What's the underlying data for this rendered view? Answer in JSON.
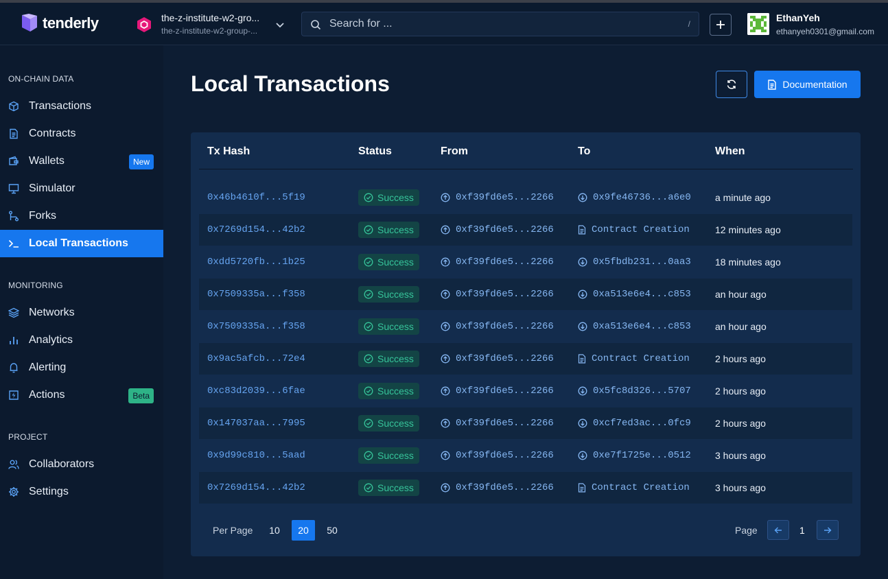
{
  "app": {
    "brand": "tenderly"
  },
  "project": {
    "name": "the-z-institute-w2-gro...",
    "slug": "the-z-institute-w2-group-..."
  },
  "search": {
    "placeholder": "Search for ...",
    "shortcut": "/"
  },
  "user": {
    "name": "EthanYeh",
    "email": "ethanyeh0301@gmail.com"
  },
  "sidebar": {
    "sections": [
      {
        "title": "ON-CHAIN DATA"
      },
      {
        "title": "MONITORING"
      },
      {
        "title": "PROJECT"
      }
    ],
    "items": [
      {
        "label": "Transactions",
        "icon": "cube-icon"
      },
      {
        "label": "Contracts",
        "icon": "file-icon"
      },
      {
        "label": "Wallets",
        "icon": "wallet-icon",
        "badge": "New"
      },
      {
        "label": "Simulator",
        "icon": "monitor-icon"
      },
      {
        "label": "Forks",
        "icon": "fork-icon"
      },
      {
        "label": "Local Transactions",
        "icon": "terminal-icon",
        "active": true
      },
      {
        "label": "Networks",
        "icon": "layers-icon"
      },
      {
        "label": "Analytics",
        "icon": "bar-chart-icon"
      },
      {
        "label": "Alerting",
        "icon": "bell-icon"
      },
      {
        "label": "Actions",
        "icon": "lightning-icon",
        "badge": "Beta"
      },
      {
        "label": "Collaborators",
        "icon": "users-icon"
      },
      {
        "label": "Settings",
        "icon": "gear-icon"
      }
    ]
  },
  "main": {
    "title": "Local Transactions",
    "documentation_label": "Documentation"
  },
  "table": {
    "headers": [
      "Tx Hash",
      "Status",
      "From",
      "To",
      "When"
    ],
    "rows": [
      {
        "hash": "0x46b4610f...5f19",
        "status": "Success",
        "from": "0xf39fd6e5...2266",
        "to": "0x9fe46736...a6e0",
        "to_type": "address",
        "when": "a minute ago"
      },
      {
        "hash": "0x7269d154...42b2",
        "status": "Success",
        "from": "0xf39fd6e5...2266",
        "to": "Contract Creation",
        "to_type": "contract",
        "when": "12 minutes ago"
      },
      {
        "hash": "0xdd5720fb...1b25",
        "status": "Success",
        "from": "0xf39fd6e5...2266",
        "to": "0x5fbdb231...0aa3",
        "to_type": "address",
        "when": "18 minutes ago"
      },
      {
        "hash": "0x7509335a...f358",
        "status": "Success",
        "from": "0xf39fd6e5...2266",
        "to": "0xa513e6e4...c853",
        "to_type": "address",
        "when": "an hour ago"
      },
      {
        "hash": "0x7509335a...f358",
        "status": "Success",
        "from": "0xf39fd6e5...2266",
        "to": "0xa513e6e4...c853",
        "to_type": "address",
        "when": "an hour ago"
      },
      {
        "hash": "0x9ac5afcb...72e4",
        "status": "Success",
        "from": "0xf39fd6e5...2266",
        "to": "Contract Creation",
        "to_type": "contract",
        "when": "2 hours ago"
      },
      {
        "hash": "0xc83d2039...6fae",
        "status": "Success",
        "from": "0xf39fd6e5...2266",
        "to": "0x5fc8d326...5707",
        "to_type": "address",
        "when": "2 hours ago"
      },
      {
        "hash": "0x147037aa...7995",
        "status": "Success",
        "from": "0xf39fd6e5...2266",
        "to": "0xcf7ed3ac...0fc9",
        "to_type": "address",
        "when": "2 hours ago"
      },
      {
        "hash": "0x9d99c810...5aad",
        "status": "Success",
        "from": "0xf39fd6e5...2266",
        "to": "0xe7f1725e...0512",
        "to_type": "address",
        "when": "3 hours ago"
      },
      {
        "hash": "0x7269d154...42b2",
        "status": "Success",
        "from": "0xf39fd6e5...2266",
        "to": "Contract Creation",
        "to_type": "contract",
        "when": "3 hours ago"
      }
    ]
  },
  "pagination": {
    "per_page_label": "Per Page",
    "per_page_options": [
      "10",
      "20",
      "50"
    ],
    "per_page_selected": "20",
    "page_label": "Page",
    "current_page": "1"
  },
  "colors": {
    "accent": "#1677ee",
    "success": "#36c49a",
    "hash_link": "#66a4f0",
    "background": "#0d1d33"
  }
}
